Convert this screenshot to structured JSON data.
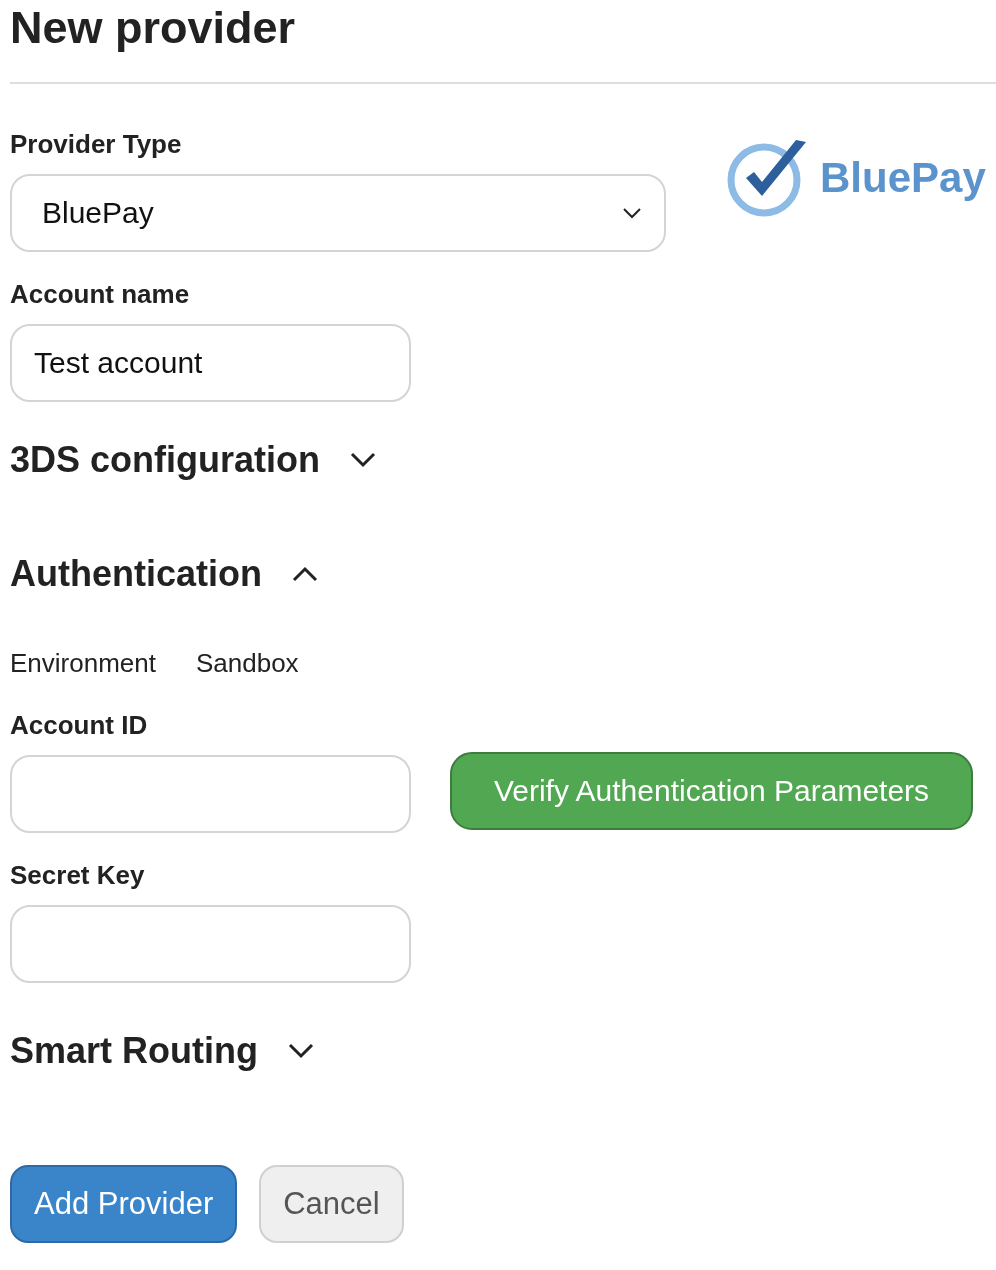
{
  "title": "New provider",
  "provider_type": {
    "label": "Provider Type",
    "value": "BluePay"
  },
  "logo": {
    "text": "BluePay"
  },
  "account_name": {
    "label": "Account name",
    "value": "Test account"
  },
  "sections": [
    {
      "title": "3DS configuration",
      "expanded": false
    },
    {
      "title": "Authentication",
      "expanded": true
    }
  ],
  "environment": {
    "label": "Environment",
    "value": "Sandbox"
  },
  "account_id": {
    "label": "Account ID"
  },
  "verify_button": "Verify Authentication Parameters",
  "secret_key": {
    "label": "Secret Key"
  },
  "smart_routing": {
    "title": "Smart Routing",
    "expanded": false
  },
  "buttons": [
    {
      "label": "Add Provider",
      "kind": "primary"
    },
    {
      "label": "Cancel",
      "kind": "secondary"
    }
  ]
}
